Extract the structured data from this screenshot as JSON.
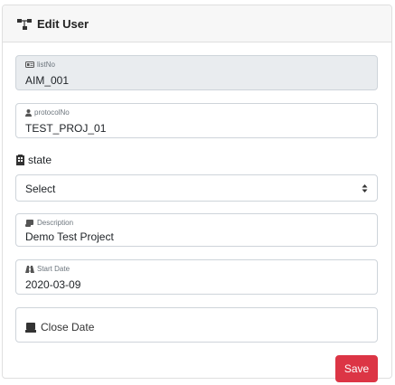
{
  "header": {
    "title": "Edit User",
    "icon": "sitemap-icon"
  },
  "fields": {
    "list_no": {
      "label": "listNo",
      "value": "AIM_001",
      "icon": "id-card-icon"
    },
    "protocol_no": {
      "label": "protocolNo",
      "value": "TEST_PROJ_01",
      "icon": "user-icon"
    },
    "state": {
      "label": "state",
      "selected": "Select",
      "icon": "building-icon"
    },
    "description": {
      "label": "Description",
      "value": "Demo Test Project",
      "icon": "scroll-icon"
    },
    "start_date": {
      "label": "Start Date",
      "value": "2020-03-09",
      "icon": "road-icon"
    },
    "close_date": {
      "placeholder": "Close Date",
      "icon": "calendar-icon"
    }
  },
  "actions": {
    "save_label": "Save"
  },
  "colors": {
    "danger": "#dc3545",
    "readonly_bg": "#e9ecef",
    "border": "#ced4da"
  }
}
